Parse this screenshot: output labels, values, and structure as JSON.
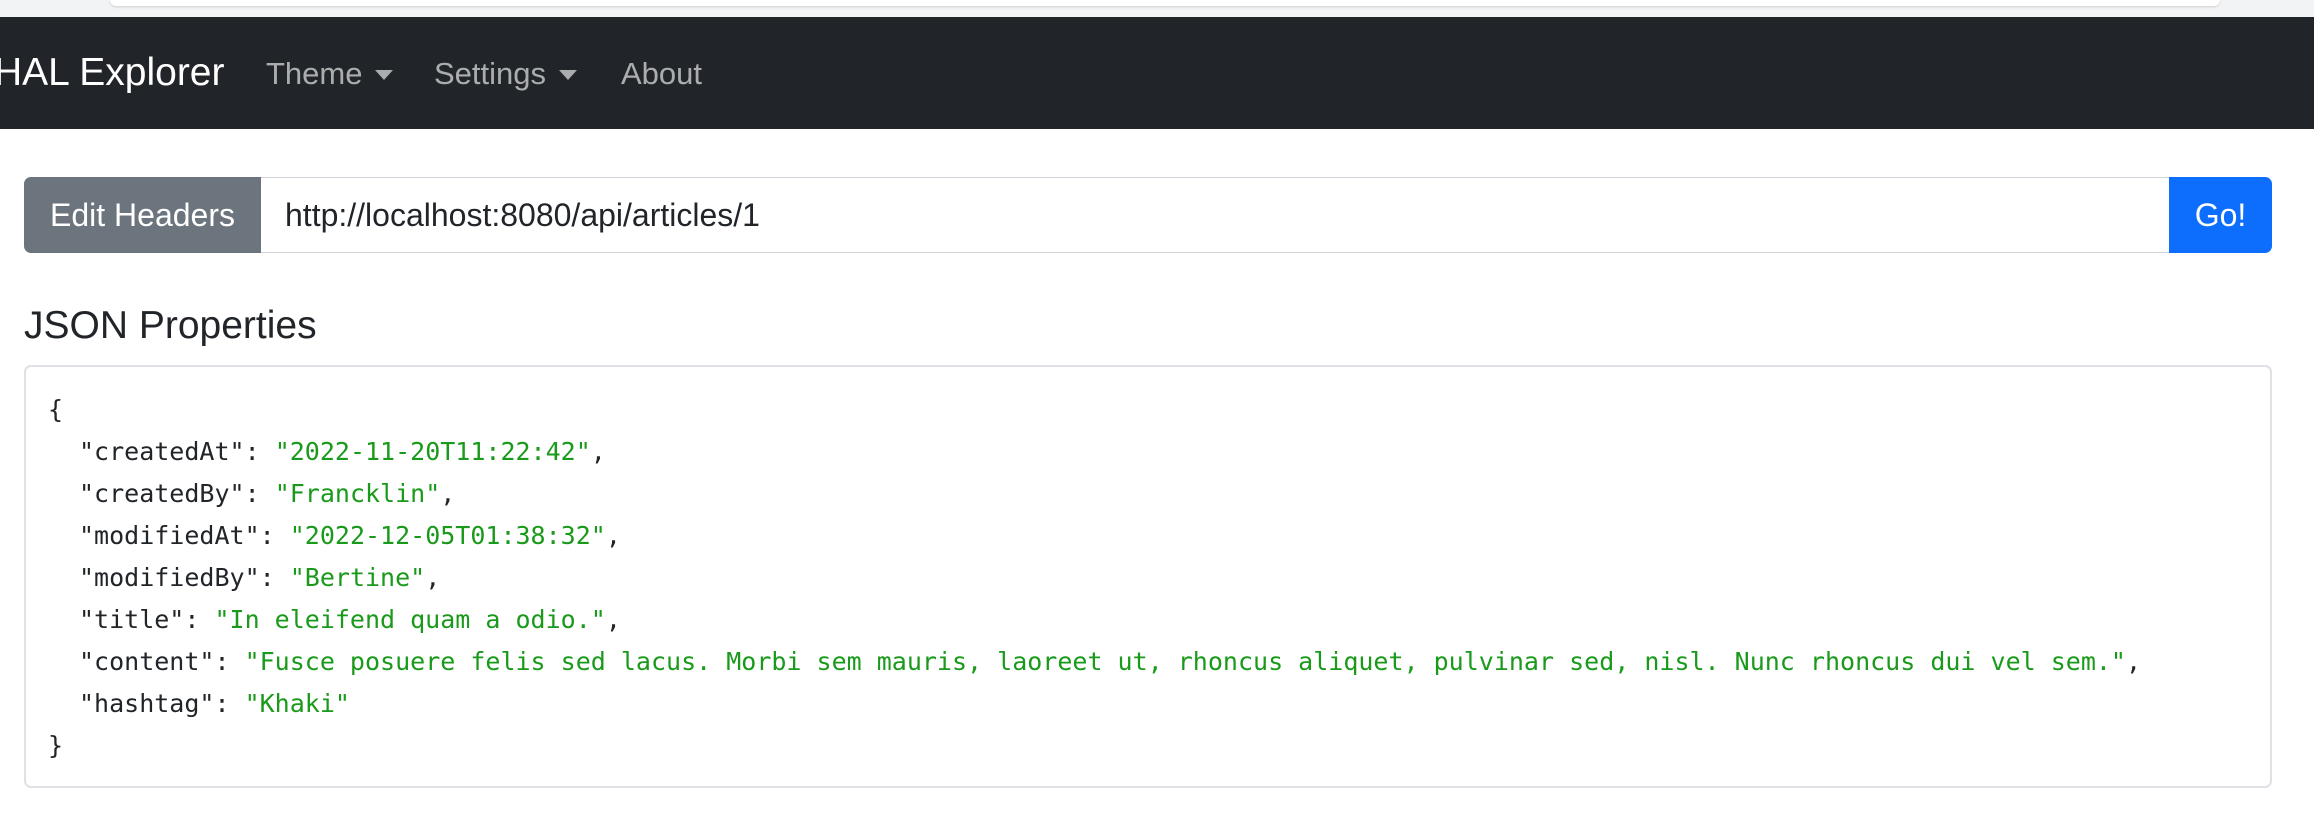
{
  "navbar": {
    "brand": "HAL Explorer",
    "items": [
      {
        "label": "Theme",
        "dropdown": true
      },
      {
        "label": "Settings",
        "dropdown": true
      },
      {
        "label": "About",
        "dropdown": false
      }
    ]
  },
  "request": {
    "edit_headers_label": "Edit Headers",
    "url": "http://localhost:8080/api/articles/1",
    "go_label": "Go!"
  },
  "json_section": {
    "title": "JSON Properties",
    "open_brace": "{",
    "close_brace": "}",
    "properties": [
      {
        "key": "\"createdAt\"",
        "value": "\"2022-11-20T11:22:42\"",
        "sep": ","
      },
      {
        "key": "\"createdBy\"",
        "value": "\"Francklin\"",
        "sep": ","
      },
      {
        "key": "\"modifiedAt\"",
        "value": "\"2022-12-05T01:38:32\"",
        "sep": ","
      },
      {
        "key": "\"modifiedBy\"",
        "value": "\"Bertine\"",
        "sep": ","
      },
      {
        "key": "\"title\"",
        "value": "\"In eleifend quam a odio.\"",
        "sep": ","
      },
      {
        "key": "\"content\"",
        "value": "\"Fusce posuere felis sed lacus. Morbi sem mauris, laoreet ut, rhoncus aliquet, pulvinar sed, nisl. Nunc rhoncus dui vel sem.\"",
        "sep": ","
      },
      {
        "key": "\"hashtag\"",
        "value": "\"Khaki\"",
        "sep": ""
      }
    ]
  },
  "colors": {
    "navbar_bg": "#212529",
    "secondary_button": "#6c757d",
    "primary_button": "#0d6efd",
    "json_string": "#1a9a1a"
  },
  "icons": {
    "dropdown": "caret-down-icon"
  }
}
